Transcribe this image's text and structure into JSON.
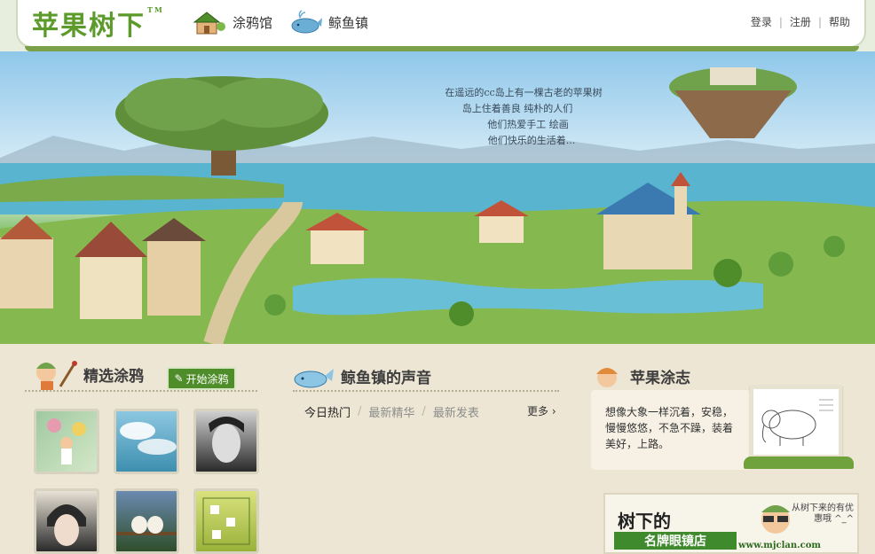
{
  "header": {
    "logo": "苹果树下",
    "logo_tm": "TM",
    "nav": [
      {
        "label": "涂鸦馆",
        "icon": "house-icon"
      },
      {
        "label": "鲸鱼镇",
        "icon": "whale-icon"
      }
    ],
    "auth": {
      "login": "登录",
      "register": "注册",
      "help": "帮助",
      "separator": "|"
    }
  },
  "hero": {
    "story": [
      "在遥远的cc岛上有一棵古老的苹果树",
      "岛上住着善良  纯朴的人们",
      "他们热爱手工  绘画",
      "他们快乐的生活着..."
    ]
  },
  "doodle": {
    "title": "精选涂鸦",
    "start_button": "开始涂鸦",
    "thumbnails": [
      "doodle-girl-balloons",
      "doodle-clouds",
      "doodle-portrait-man",
      "doodle-portrait-woman",
      "doodle-birds",
      "doodle-board-game"
    ]
  },
  "whale_town": {
    "title": "鲸鱼镇的声音",
    "tabs": [
      "今日热门",
      "最新精华",
      "最新发表"
    ],
    "more": "更多"
  },
  "apple_journal": {
    "title": "苹果涂志",
    "text": "想像大象一样沉着，安稳，慢慢悠悠，不急不躁，装着美好，上路。"
  },
  "ad": {
    "title": "树下的",
    "subtitle": "名牌眼镜店",
    "url": "www.mjclan.com",
    "note": "从树下来的有优惠哦 ^_^"
  },
  "colors": {
    "brand_green": "#5c9b2b",
    "button_green": "#4f8d2a",
    "background": "#ede6d4"
  }
}
